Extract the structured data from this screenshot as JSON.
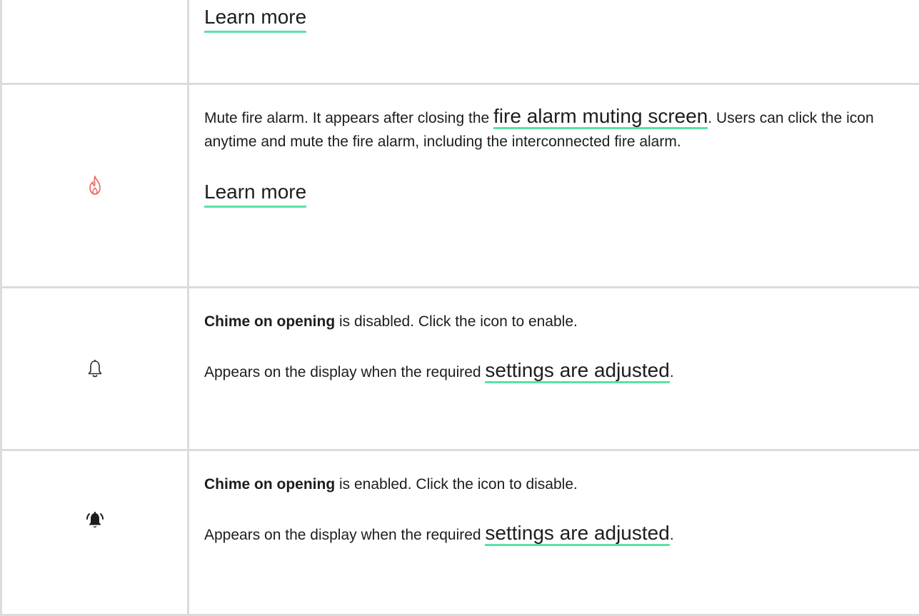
{
  "row1": {
    "link": "Learn more"
  },
  "row2": {
    "icon": "fire-icon",
    "icon_color": "#e8645a",
    "text_before": "Mute fire alarm. It appears after closing the ",
    "inline_link": "fire alarm muting screen",
    "text_after": ". Users can click the icon anytime and mute the fire alarm, including the interconnected fire alarm.",
    "link": "Learn more"
  },
  "row3": {
    "icon": "bell-outline-icon",
    "bold": "Chime on opening",
    "line1_rest": " is disabled. Click the icon to enable.",
    "line2_before": "Appears on the display when the required ",
    "line2_link": "settings are adjusted",
    "line2_after": "."
  },
  "row4": {
    "icon": "bell-ringing-icon",
    "bold": "Chime on opening",
    "line1_rest": " is enabled. Click the icon to disable.",
    "line2_before": "Appears on the display when the required ",
    "line2_link": "settings are adjusted",
    "line2_after": "."
  },
  "accent_color": "#5ce0a7",
  "border_color": "#dcdcdc"
}
